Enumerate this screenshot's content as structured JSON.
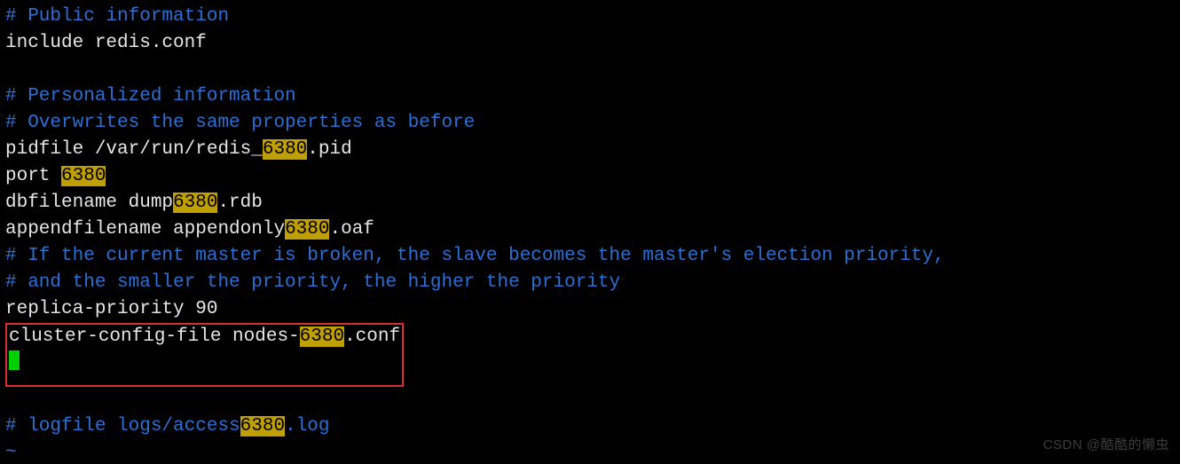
{
  "lines": {
    "l1": "# Public information",
    "l2": "include redis.conf",
    "l3": "",
    "l4": "# Personalized information",
    "l5": "# Overwrites the same properties as before",
    "l6a": "pidfile /var/run/redis_",
    "l6b": "6380",
    "l6c": ".pid",
    "l7a": "port ",
    "l7b": "6380",
    "l8a": "dbfilename dump",
    "l8b": "6380",
    "l8c": ".rdb",
    "l9a": "appendfilename appendonly",
    "l9b": "6380",
    "l9c": ".oaf",
    "l10": "# If the current master is broken, the slave becomes the master's election priority,",
    "l11": "# and the smaller the priority, the higher the priority",
    "l12": "replica-priority 90",
    "l13a": "cluster-config-file nodes-",
    "l13b": "6380",
    "l13c": ".conf",
    "l15a": "# logfile logs/access",
    "l15b": "6380",
    "l15c": ".log",
    "tilde": "~"
  },
  "watermark": "CSDN @酷酷的懒虫"
}
